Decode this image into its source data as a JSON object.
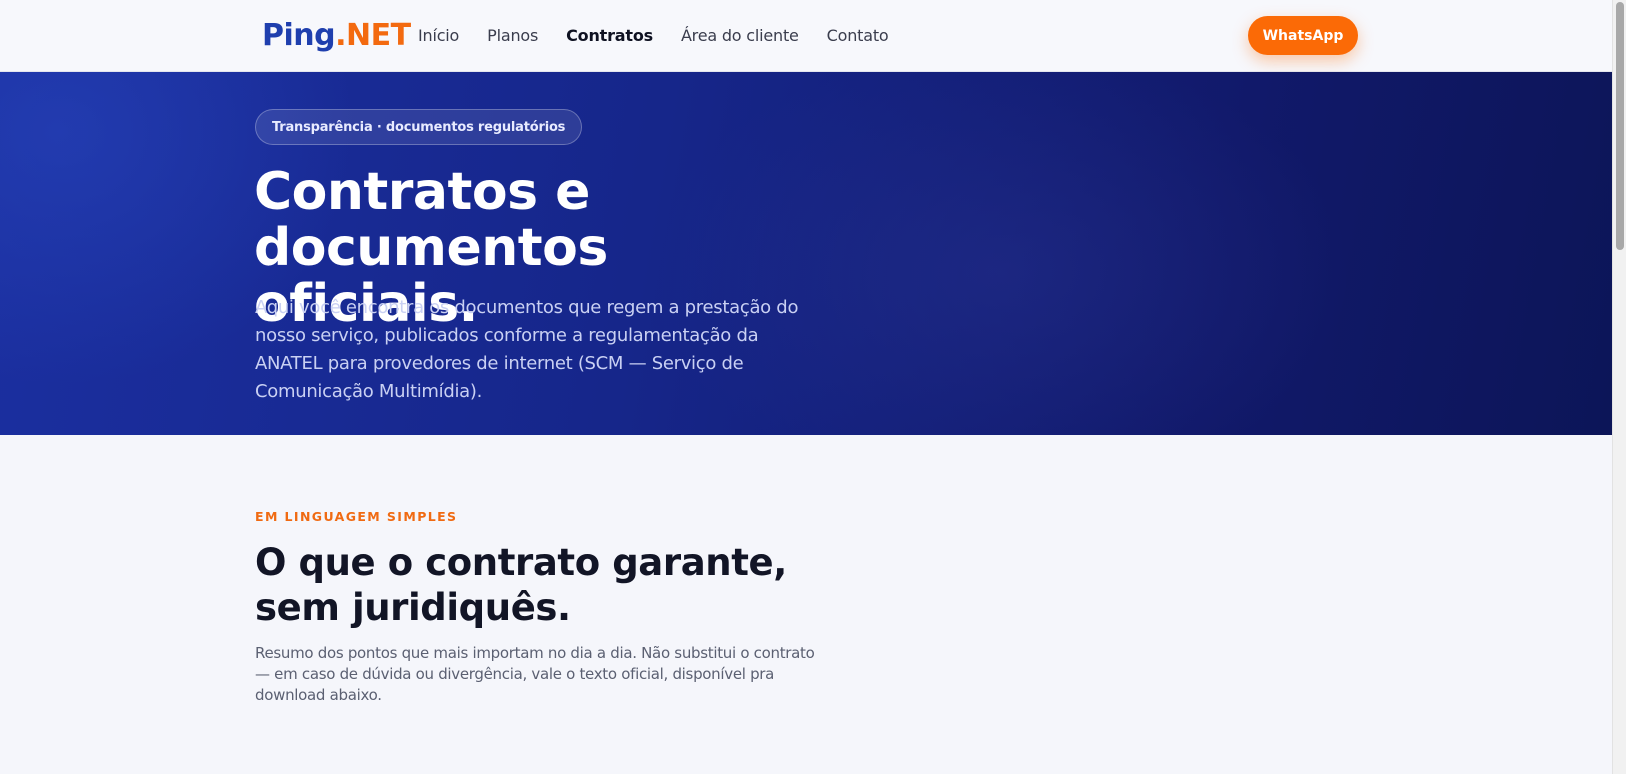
{
  "header": {
    "logo_main": "Ping",
    "logo_accent": ".NET",
    "nav": [
      {
        "label": "Início"
      },
      {
        "label": "Planos"
      },
      {
        "label": "Contratos"
      },
      {
        "label": "Área do cliente"
      },
      {
        "label": "Contato"
      }
    ],
    "active_nav": "Contratos",
    "cta_label": "WhatsApp"
  },
  "hero": {
    "badge": "Transparência · documentos regulatórios",
    "title_line1": "Contratos e documentos",
    "title_line2": "oficiais.",
    "description": "Aqui você encontra os documentos que regem a prestação do nosso serviço, publicados conforme a regulamentação da ANATEL para provedores de internet (SCM — Serviço de Comunicação Multimídia)."
  },
  "section": {
    "eyebrow": "EM LINGUAGEM SIMPLES",
    "title_line1": "O que o contrato garante,",
    "title_line2": "sem juridiquês.",
    "description": "Resumo dos pontos que mais importam no dia a dia. Não substitui o contrato — em caso de dúvida ou divergência, vale o texto oficial, disponível pra download abaixo."
  },
  "colors": {
    "brand_blue": "#1f3fae",
    "brand_orange": "#fb6a06",
    "hero_bg": "#16268a"
  }
}
